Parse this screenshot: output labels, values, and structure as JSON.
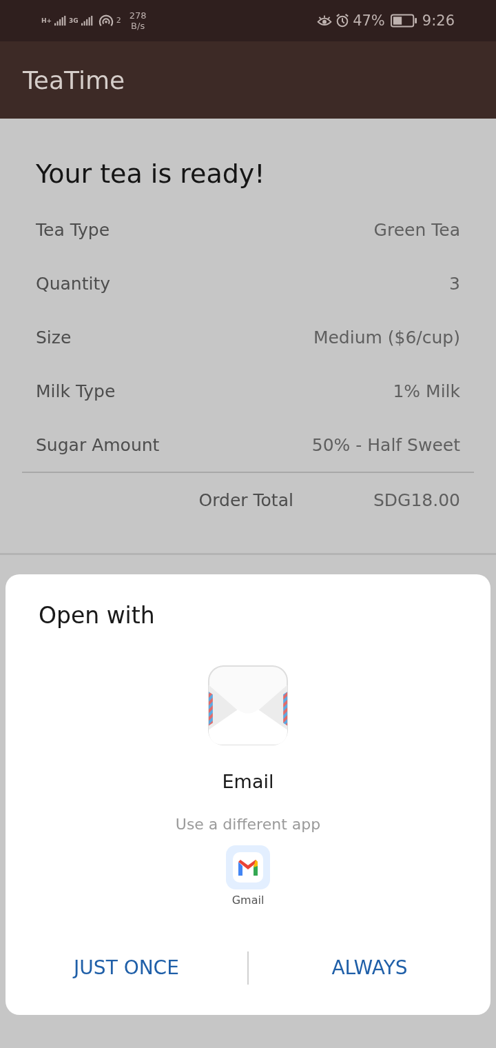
{
  "status_bar": {
    "network_1": "H+",
    "network_2": "3G",
    "hotspot_count": "2",
    "speed": "278",
    "speed_unit": "B/s",
    "battery_percent": "47%",
    "time": "9:26"
  },
  "app_bar": {
    "title": "TeaTime"
  },
  "order": {
    "heading": "Your tea is ready!",
    "rows": [
      {
        "label": "Tea Type",
        "value": "Green Tea"
      },
      {
        "label": "Quantity",
        "value": "3"
      },
      {
        "label": "Size",
        "value": "Medium ($6/cup)"
      },
      {
        "label": "Milk Type",
        "value": "1% Milk"
      },
      {
        "label": "Sugar Amount",
        "value": "50% - Half Sweet"
      }
    ],
    "total_label": "Order Total",
    "total_value": "SDG18.00"
  },
  "dialog": {
    "title": "Open with",
    "primary_app": "Email",
    "other_label": "Use a different app",
    "other_apps": [
      "Gmail"
    ],
    "buttons": [
      "JUST ONCE",
      "ALWAYS"
    ]
  }
}
